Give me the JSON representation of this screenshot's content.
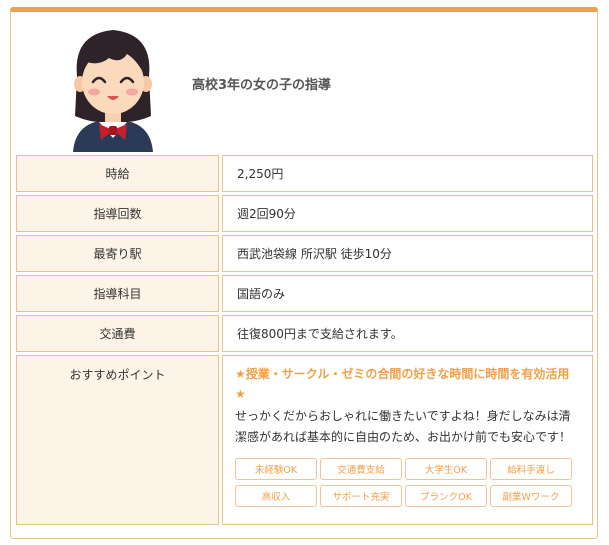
{
  "header": {
    "title": "高校3年の女の子の指導",
    "avatar_icon": "student-girl-icon"
  },
  "rows": [
    {
      "label": "時給",
      "value": "2,250円"
    },
    {
      "label": "指導回数",
      "value": "週2回90分"
    },
    {
      "label": "最寄り駅",
      "value": "西武池袋線 所沢駅 徒歩10分"
    },
    {
      "label": "指導科目",
      "value": "国語のみ"
    },
    {
      "label": "交通費",
      "value": "往復800円まで支給されます。"
    }
  ],
  "point": {
    "label": "おすすめポイント",
    "catch_line1": "★授業・サークル・ゼミの合間の好きな時間に時間を有効活用",
    "catch_line2": "★",
    "desc_line1": "せっかくだからおしゃれに働きたいですよね！身だしなみは清",
    "desc_line2": "潔感があれば基本的に自由のため、お出かけ前でも安心です！",
    "tags": [
      "未経験OK",
      "交通費支給",
      "大学生OK",
      "給料手渡し",
      "高収入",
      "サポート充実",
      "ブランクOK",
      "副業Wワーク"
    ]
  },
  "colors": {
    "accent": "#f0a04b",
    "border": "#e9c08a",
    "header_cell_bg": "#fdf3e7"
  }
}
